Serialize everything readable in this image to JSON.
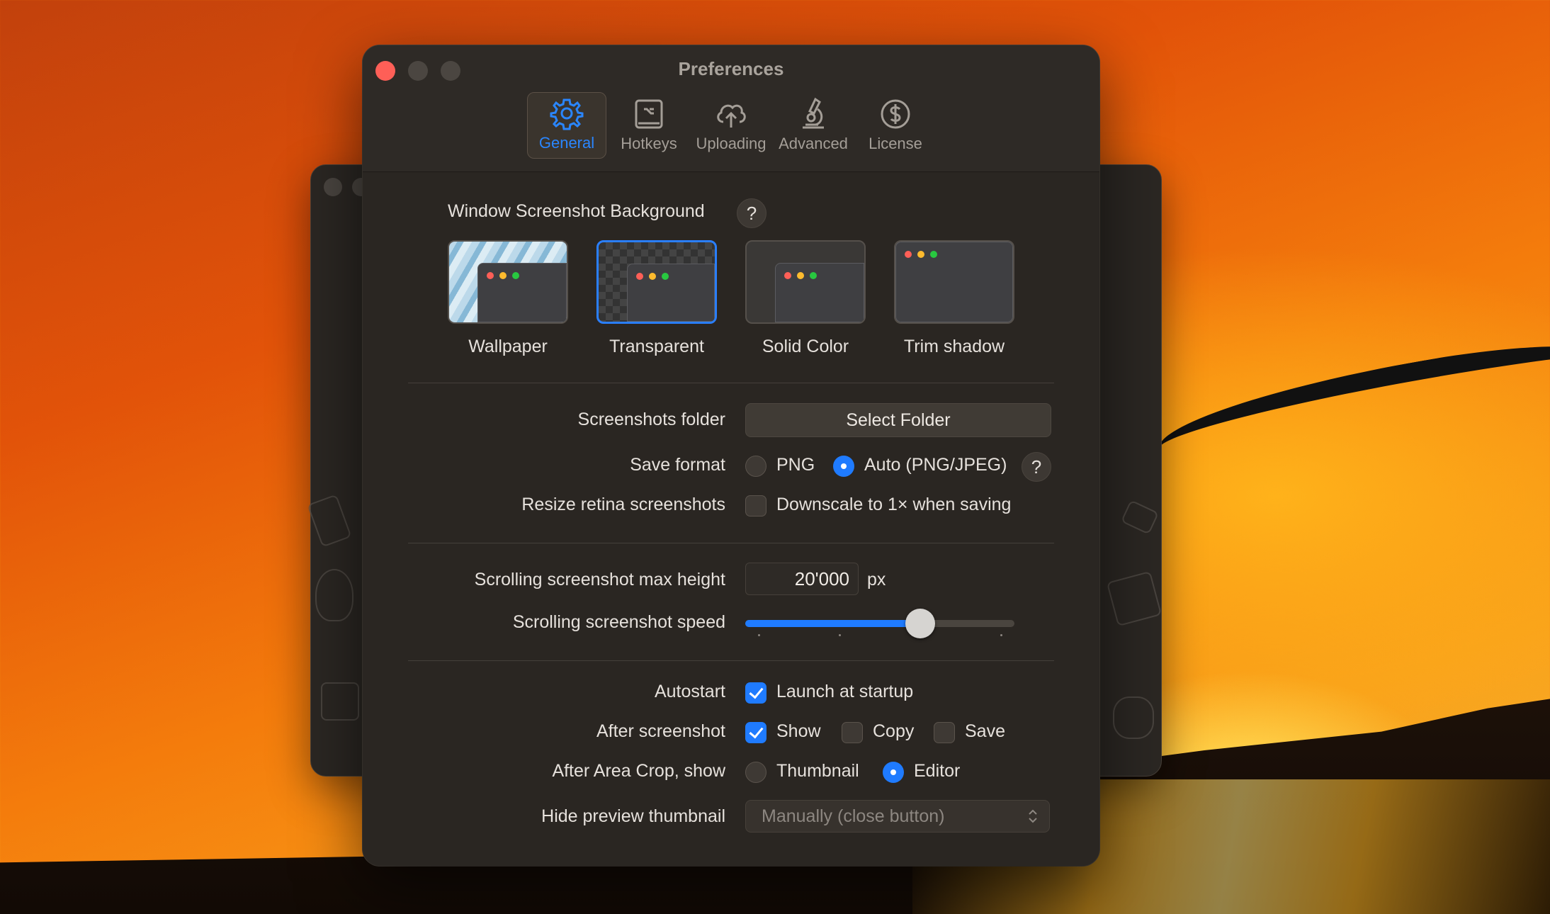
{
  "window": {
    "title": "Preferences"
  },
  "tabs": [
    {
      "label": "General",
      "icon": "gear-icon",
      "active": true
    },
    {
      "label": "Hotkeys",
      "icon": "keyboard-icon",
      "active": false
    },
    {
      "label": "Uploading",
      "icon": "cloud-upload-icon",
      "active": false
    },
    {
      "label": "Advanced",
      "icon": "microscope-icon",
      "active": false
    },
    {
      "label": "License",
      "icon": "dollar-circle-icon",
      "active": false
    }
  ],
  "background_section": {
    "title": "Window Screenshot Background",
    "help": "?",
    "options": [
      {
        "label": "Wallpaper",
        "selected": false
      },
      {
        "label": "Transparent",
        "selected": true
      },
      {
        "label": "Solid Color",
        "selected": false
      },
      {
        "label": "Trim shadow",
        "selected": false
      }
    ]
  },
  "folder": {
    "label": "Screenshots folder",
    "button": "Select Folder"
  },
  "save_format": {
    "label": "Save format",
    "options": [
      {
        "label": "PNG",
        "selected": false
      },
      {
        "label": "Auto (PNG/JPEG)",
        "selected": true
      }
    ],
    "help": "?"
  },
  "resize": {
    "label": "Resize retina screenshots",
    "checkbox_label": "Downscale to 1× when saving",
    "checked": false
  },
  "scrolling": {
    "max_height_label": "Scrolling screenshot max height",
    "max_height_value": "20'000",
    "unit": "px",
    "speed_label": "Scrolling screenshot speed",
    "speed_fraction": 0.65
  },
  "autostart": {
    "label": "Autostart",
    "checkbox_label": "Launch at startup",
    "checked": true
  },
  "after_screenshot": {
    "label": "After screenshot",
    "options": [
      {
        "label": "Show",
        "checked": true
      },
      {
        "label": "Copy",
        "checked": false
      },
      {
        "label": "Save",
        "checked": false
      }
    ]
  },
  "after_area_crop": {
    "label": "After Area Crop, show",
    "options": [
      {
        "label": "Thumbnail",
        "selected": false
      },
      {
        "label": "Editor",
        "selected": true
      }
    ]
  },
  "hide_preview": {
    "label": "Hide preview thumbnail",
    "value": "Manually (close button)"
  },
  "colors": {
    "accent": "#1f7bff",
    "window_bg": "#2a2622",
    "close_button": "#fe5f57"
  }
}
